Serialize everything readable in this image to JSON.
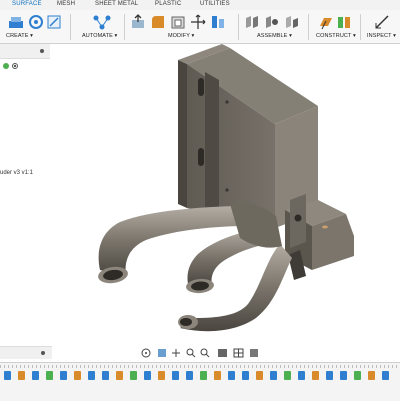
{
  "tabs": [
    "SURFACE",
    "MESH",
    "SHEET METAL",
    "PLASTIC",
    "UTILITIES"
  ],
  "groups": {
    "create": "CREATE",
    "automate": "AUTOMATE",
    "modify": "MODIFY",
    "assemble": "ASSEMBLE",
    "construct": "CONSTRUCT",
    "inspect": "INSPECT"
  },
  "browser": {
    "component_label": "uder v3 v1:1"
  },
  "colors": {
    "accent": "#0a6fbd",
    "model_body": "#6f6a62",
    "model_dark": "#3f3b36",
    "model_light": "#9a948b",
    "timeline_blue": "#2f7fd1",
    "timeline_orange": "#d98a2b",
    "timeline_green": "#4caf50"
  },
  "icons": {
    "create": [
      "extrude-icon",
      "revolve-icon",
      "sketch-icon"
    ],
    "automate": "automate-icon",
    "modify": [
      "press-pull-icon",
      "fillet-icon",
      "shell-icon"
    ],
    "assemble": [
      "joint-icon",
      "as-built-joint-icon",
      "rigid-group-icon"
    ],
    "construct": [
      "offset-plane-icon",
      "midplane-icon"
    ],
    "inspect": "measure-icon"
  }
}
